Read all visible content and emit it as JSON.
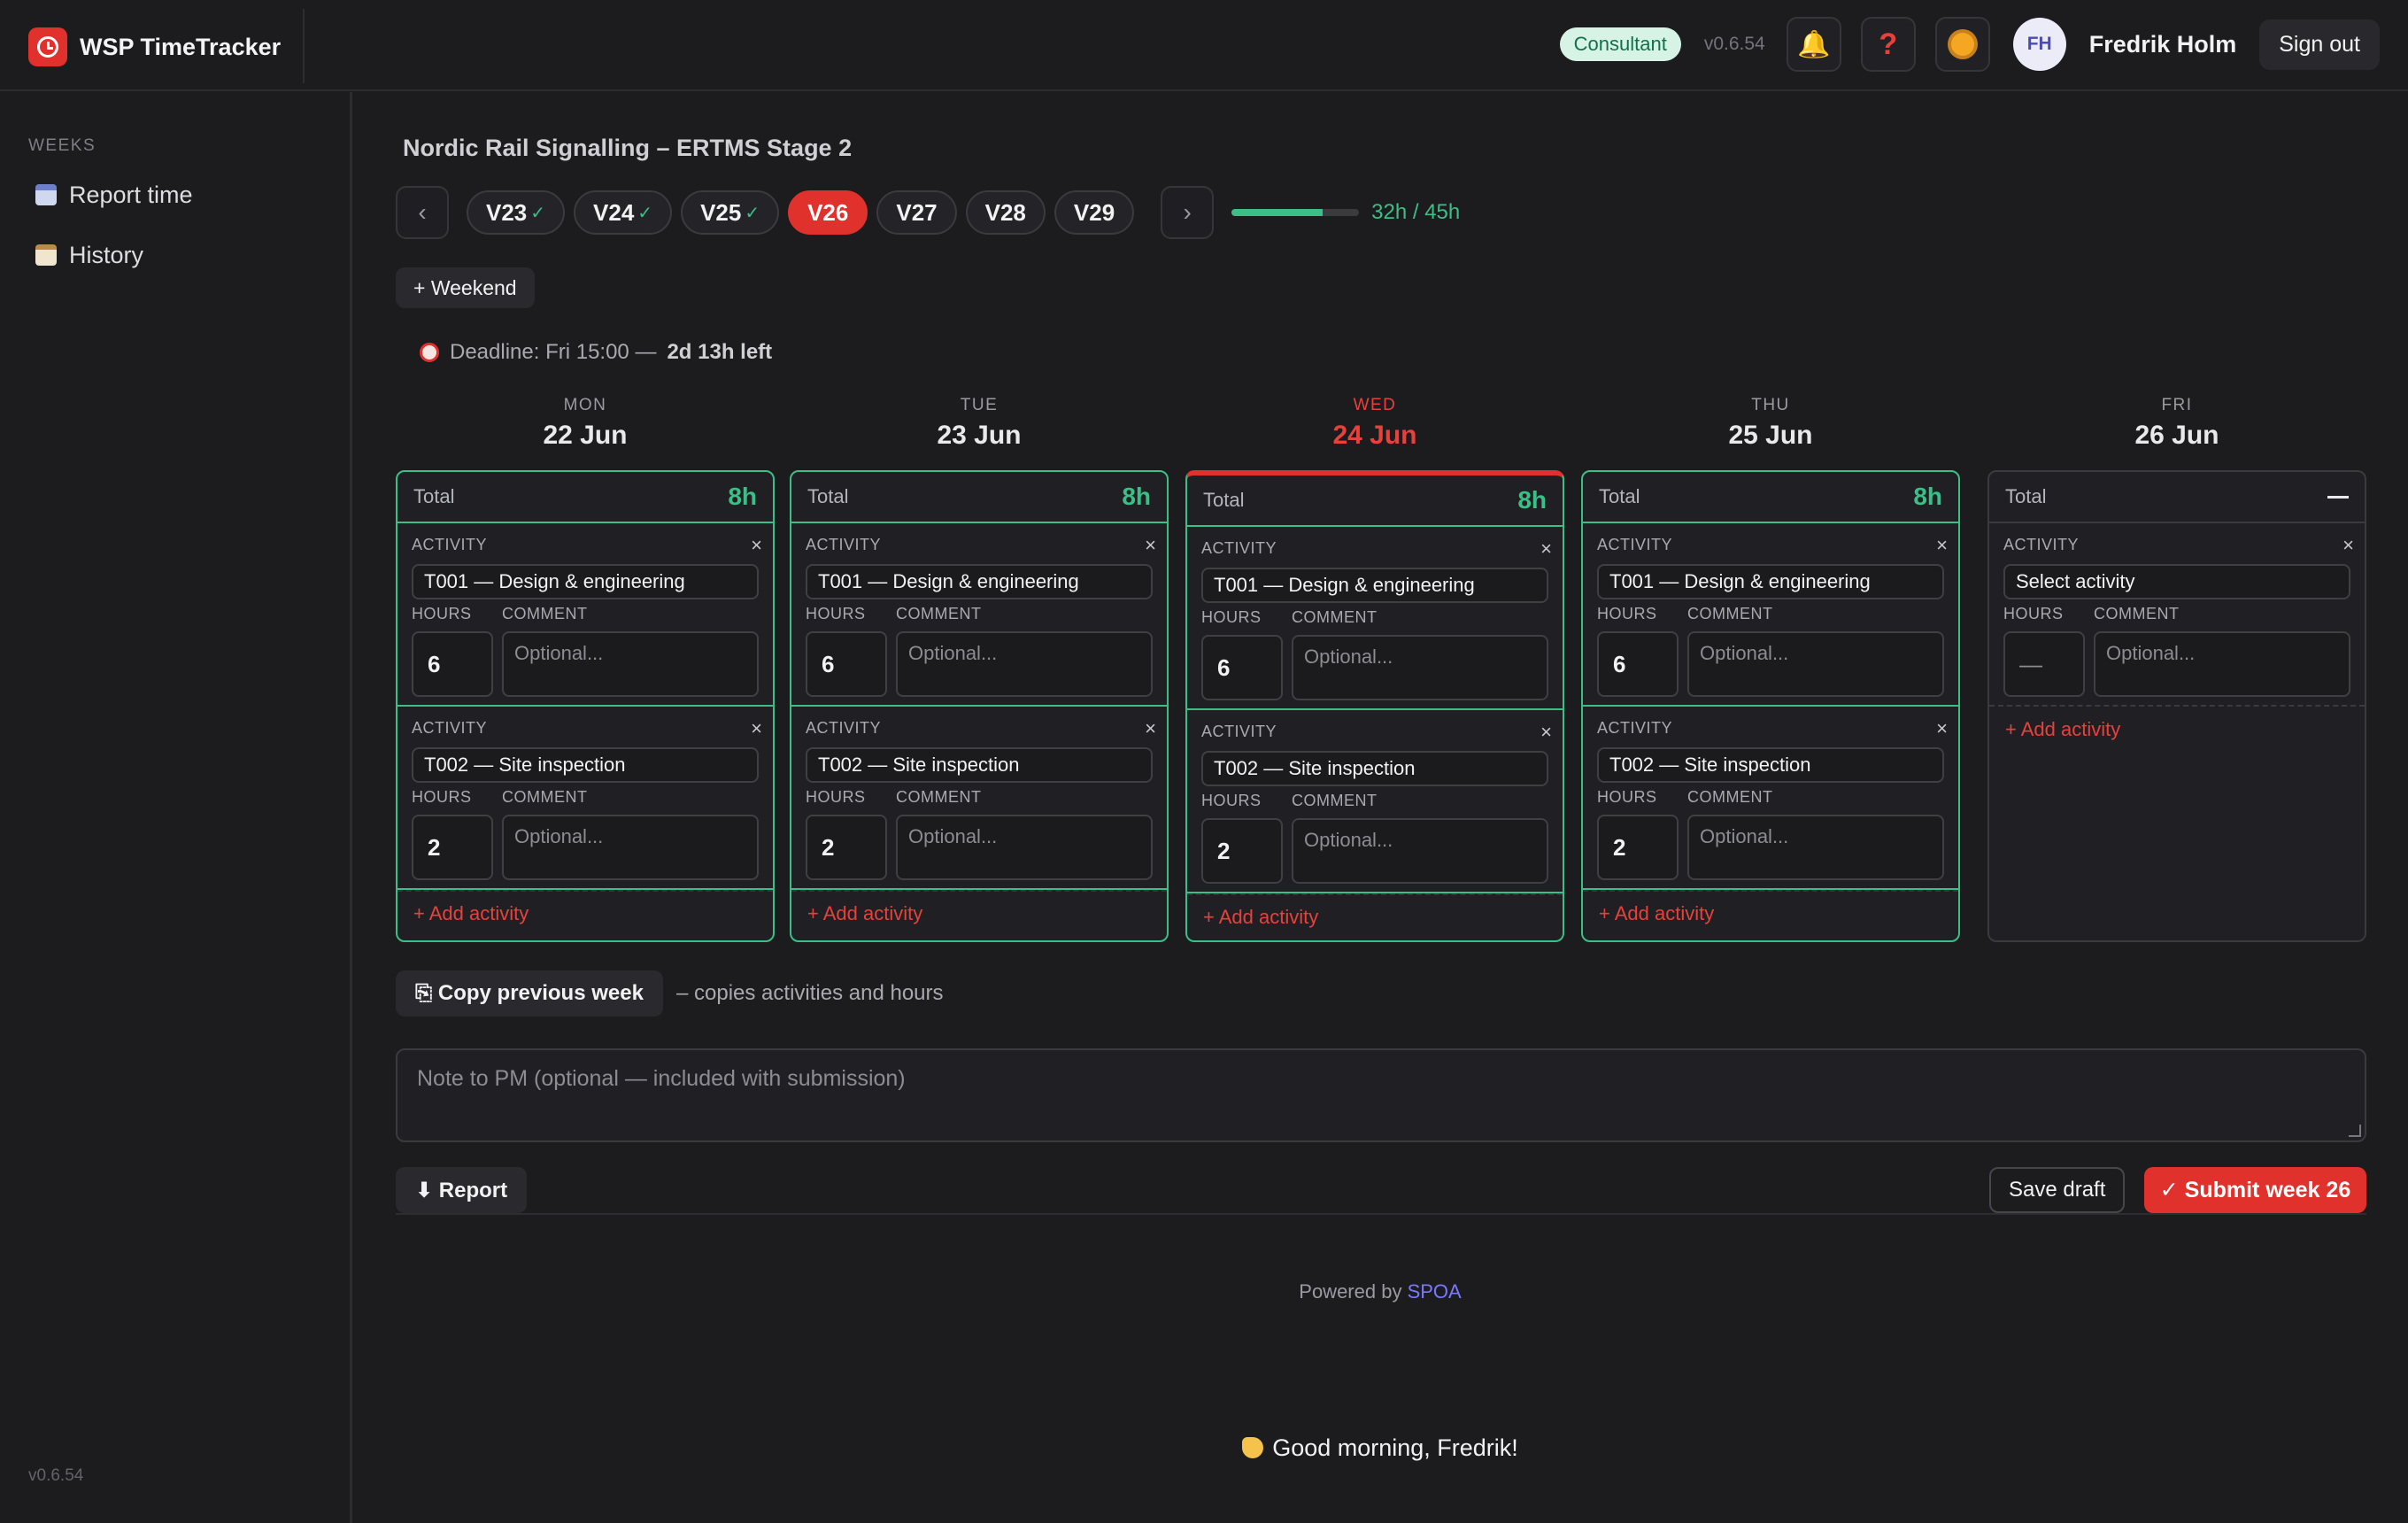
{
  "app": {
    "name": "WSP TimeTracker",
    "version": "v0.6.54"
  },
  "header": {
    "role": "Consultant",
    "version": "v0.6.54",
    "user_initials": "FH",
    "user_name": "Fredrik Holm",
    "sign_out": "Sign out"
  },
  "sidebar": {
    "heading": "WEEKS",
    "items": [
      {
        "label": "Report time",
        "icon": "calendar-icon"
      },
      {
        "label": "History",
        "icon": "notepad-icon"
      }
    ],
    "version": "v0.6.54"
  },
  "project": "Nordic Rail Signalling – ERTMS Stage 2",
  "weeks": [
    {
      "label": "V23",
      "check": "✓"
    },
    {
      "label": "V24",
      "check": "✓"
    },
    {
      "label": "V25",
      "check": "✓"
    },
    {
      "label": "V26",
      "check": ""
    },
    {
      "label": "V27",
      "check": ""
    },
    {
      "label": "V28",
      "check": ""
    },
    {
      "label": "V29",
      "check": ""
    }
  ],
  "progress": {
    "text": "32h / 45h",
    "fraction": 0.711
  },
  "weekend_button": "+ Weekend",
  "deadline": {
    "label": "Deadline: Fri 15:00 —",
    "remaining": "2d 13h left"
  },
  "labels": {
    "total": "Total",
    "activity": "ACTIVITY",
    "hours": "HOURS",
    "comment": "COMMENT",
    "comment_placeholder": "Optional...",
    "add_activity": "+ Add activity",
    "remove": "×"
  },
  "days": [
    {
      "dow": "MON",
      "date": "22 Jun",
      "total": "8h",
      "entries": [
        {
          "activity": "T001 — Design & engineering",
          "hours": "6"
        },
        {
          "activity": "T002 — Site inspection",
          "hours": "2"
        }
      ]
    },
    {
      "dow": "TUE",
      "date": "23 Jun",
      "total": "8h",
      "entries": [
        {
          "activity": "T001 — Design & engineering",
          "hours": "6"
        },
        {
          "activity": "T002 — Site inspection",
          "hours": "2"
        }
      ]
    },
    {
      "dow": "WED",
      "date": "24 Jun",
      "total": "8h",
      "entries": [
        {
          "activity": "T001 — Design & engineering",
          "hours": "6"
        },
        {
          "activity": "T002 — Site inspection",
          "hours": "2"
        }
      ]
    },
    {
      "dow": "THU",
      "date": "25 Jun",
      "total": "8h",
      "entries": [
        {
          "activity": "T001 — Design & engineering",
          "hours": "6"
        },
        {
          "activity": "T002 — Site inspection",
          "hours": "2"
        }
      ]
    },
    {
      "dow": "FRI",
      "date": "26 Jun",
      "total": "",
      "entries": [
        {
          "activity": "Select activity",
          "hours": "—"
        }
      ]
    }
  ],
  "copy": {
    "button": "⎘ Copy previous week",
    "note": "– copies activities and hours"
  },
  "pm_note_placeholder": "Note to PM (optional — included with submission)",
  "actions": {
    "report": "⬇ Report",
    "save_draft": "Save draft",
    "submit": "✓ Submit week 26"
  },
  "footer": {
    "powered": "Powered by",
    "brand": "SPOA",
    "greeting": "Good morning, Fredrik!"
  },
  "colors": {
    "accent": "#e0312c",
    "success": "#3cbf86",
    "background": "#1c1c1f"
  }
}
